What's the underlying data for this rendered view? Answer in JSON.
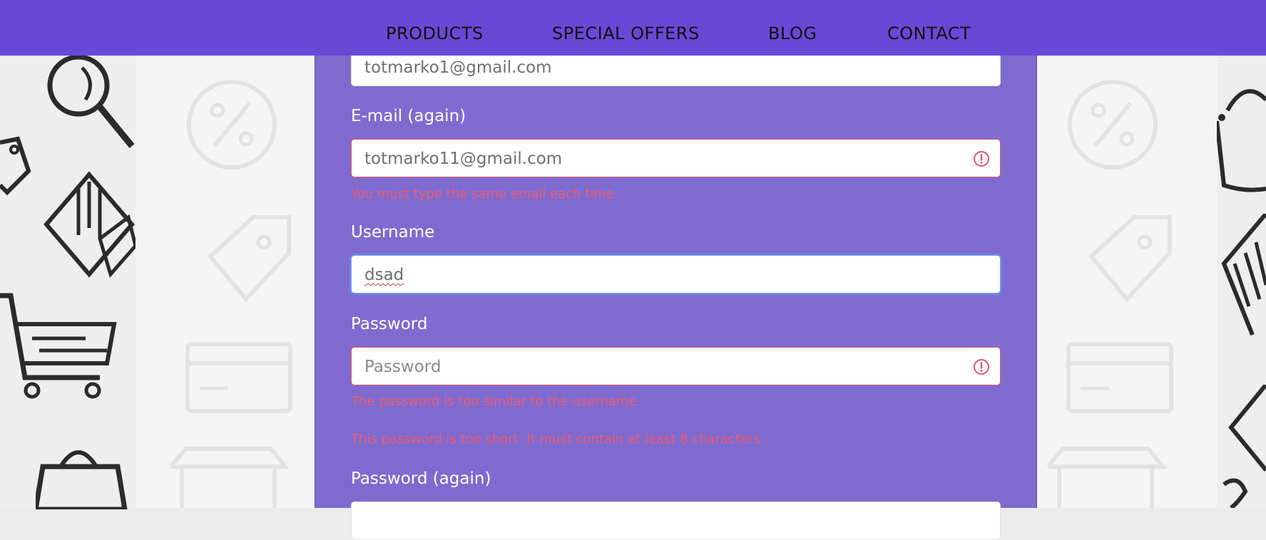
{
  "nav": {
    "items": [
      "PRODUCTS",
      "SPECIAL OFFERS",
      "BLOG",
      "CONTACT"
    ]
  },
  "form": {
    "email": {
      "value": "totmarko1@gmail.com"
    },
    "email_again": {
      "label": "E-mail (again)",
      "value": "totmarko11@gmail.com",
      "error": "You must type the same email each time."
    },
    "username": {
      "label": "Username",
      "value": "dsad"
    },
    "password": {
      "label": "Password",
      "placeholder": "Password",
      "errors": [
        "The password is too similar to the username.",
        "This password is too short. It must contain at least 8 characters."
      ]
    },
    "password_again": {
      "label": "Password (again)"
    }
  },
  "icons": {
    "alert": "alert-circle-icon",
    "background": [
      "magnifier-icon",
      "tag-icon",
      "laptop-icon",
      "cart-icon",
      "shopping-bag-icon",
      "percent-icon",
      "credit-card-icon",
      "store-icon"
    ]
  },
  "colors": {
    "navbar": "#6849d6",
    "form_panel": "#7f6bd0",
    "error": "#ef5a6f",
    "focus": "#6aa6f5"
  }
}
